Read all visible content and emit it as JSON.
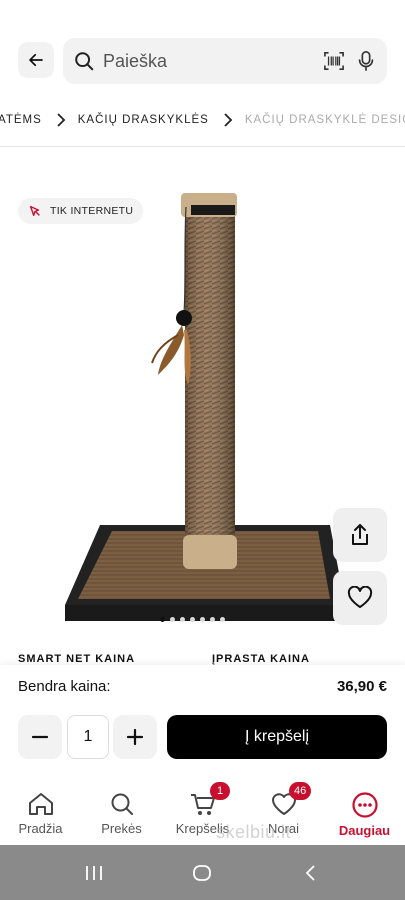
{
  "search": {
    "placeholder": "Paieška"
  },
  "breadcrumbs": [
    "ATĖMS",
    "KAČIŲ DRASKYKLĖS",
    "KAČIŲ DRASKYKLĖ DESIG..."
  ],
  "badge": {
    "label": "TIK INTERNETU"
  },
  "gallery": {
    "dot_count": 7,
    "active_index": 0
  },
  "price": {
    "smart_label": "SMART NET KAINA",
    "regular_label": "ĮPRASTA KAINA"
  },
  "cart_panel": {
    "total_label": "Bendra kaina:",
    "total_value": "36,90 €",
    "quantity": "1",
    "add_to_cart_label": "Į krepšelį"
  },
  "nav": {
    "items": [
      {
        "label": "Pradžia",
        "icon": "home-icon"
      },
      {
        "label": "Prekės",
        "icon": "search-icon"
      },
      {
        "label": "Krepšelis",
        "icon": "cart-icon",
        "badge": "1"
      },
      {
        "label": "Norai",
        "icon": "heart-icon",
        "badge": "46"
      },
      {
        "label": "Daugiau",
        "icon": "more-icon"
      }
    ],
    "active": "Daugiau"
  },
  "watermark": "skelbiu.lt",
  "colors": {
    "accent": "#c8102e",
    "primary_button": "#000000"
  }
}
